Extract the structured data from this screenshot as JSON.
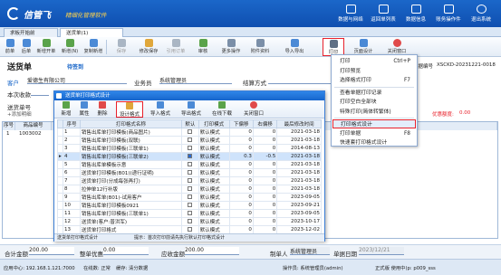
{
  "app": {
    "logo": "信管飞",
    "subtitle": "精细化管理软件"
  },
  "topbar": {
    "buttons": [
      "数据与网络",
      "返回单列表",
      "数据信息",
      "账务操作件",
      "退出系统"
    ]
  },
  "tabs": [
    "求板开始前",
    "送货单(1)"
  ],
  "toolbar": {
    "buttons": [
      "前单",
      "后单",
      "新增开单",
      "新增(N)",
      "复制新增",
      "保存",
      "修改保存",
      "引用订单",
      "审核",
      "附件资料",
      "导入导出",
      "打印",
      "页面设计",
      "关闭窗口"
    ]
  },
  "form": {
    "title": "送货单",
    "status": "待签到",
    "doc_no_label": "单据编号",
    "doc_no": "XSCKD-20231221-0018",
    "customer_label": "客户",
    "customer": "爱德生有限公司",
    "salesman_label": "业务员",
    "salesman": "系统管理员",
    "settle_label": "结算方式",
    "deposit_label": "本次收款",
    "address_label": "送货单号",
    "grid_headers": [
      "序号",
      "商品编号"
    ],
    "grid_row": [
      "1",
      "1003002"
    ],
    "discount_label": "优惠额度:",
    "discount_value": "0.00"
  },
  "dialog": {
    "title": "送货单打印格式设计",
    "toolbar": [
      "新增",
      "属性",
      "删除",
      "设计格式",
      "导入格式",
      "导出格式",
      "在线下载",
      "关闭窗口"
    ],
    "columns": [
      "序号",
      "打印格式名称",
      "默认",
      "打印模式",
      "下偏移",
      "右偏移",
      "最后修改时间"
    ],
    "rows": [
      [
        "1",
        "销售出库单打印模板(商品图片)",
        "",
        "默认模式",
        "0",
        "0",
        "2021-03-18"
      ],
      [
        "2",
        "销售出库单打印模板(双联)",
        "",
        "默认模式",
        "0",
        "0",
        "2021-03-18"
      ],
      [
        "3",
        "销售出库单打印模板(三联单1)",
        "",
        "默认模式",
        "0",
        "0",
        "2014-08-13"
      ],
      [
        "4",
        "销售出库单打印模板(三联单2)",
        "✓",
        "默认模式",
        "0.3",
        "-0.5",
        "2021-03-18"
      ],
      [
        "5",
        "销售出库单模板示意",
        "",
        "默认模式",
        "0",
        "0",
        "2021-03-18"
      ],
      [
        "6",
        "送货单打印模板(B01)(递行证明)",
        "",
        "默认模式",
        "0",
        "0",
        "2021-03-18"
      ],
      [
        "7",
        "送货单打印(分成每张再打)",
        "",
        "默认模式",
        "0",
        "0",
        "2021-03-18"
      ],
      [
        "8",
        "拉伸单12行补版",
        "",
        "默认模式",
        "0",
        "0",
        "2021-03-18"
      ],
      [
        "9",
        "销售出库单(B01)-试用客户",
        "",
        "默认模式",
        "0",
        "0",
        "2023-09-05"
      ],
      [
        "10",
        "销售出库单打印模板0921",
        "",
        "默认模式",
        "0",
        "0",
        "2023-09-21"
      ],
      [
        "11",
        "销售出库单打印模板(三联单1)",
        "",
        "默认模式",
        "0",
        "0",
        "2023-09-05"
      ],
      [
        "12",
        "送货单(客户:普洪军)",
        "",
        "默认模式",
        "0",
        "0",
        "2023-10-17"
      ],
      [
        "13",
        "送货单打印格式",
        "",
        "默认模式",
        "0",
        "0",
        "2023-12-02"
      ]
    ],
    "status": "送货单打印格式设计",
    "hint": "提示：首次打印前请先执行默认打印格式设计"
  },
  "menu": {
    "items": [
      {
        "label": "打印",
        "shortcut": "Ctrl+P"
      },
      {
        "label": "打印预览",
        "shortcut": ""
      },
      {
        "label": "选择格式打印",
        "shortcut": "F7"
      },
      {
        "label": "查看单据打印记录",
        "shortcut": ""
      },
      {
        "label": "打印空白全部块",
        "shortcut": ""
      },
      {
        "label": "特殊打印(简体转繁体)",
        "shortcut": ""
      },
      {
        "label": "打印格式设计",
        "shortcut": ""
      },
      {
        "label": "打印单据",
        "shortcut": "F8"
      },
      {
        "label": "快速套打印格式设计",
        "shortcut": ""
      }
    ]
  },
  "footer": {
    "total_label": "合计金额",
    "total": "200.00",
    "adjust_label": "整单优惠",
    "adjust": "0.00",
    "receivable_label": "应收金额",
    "receivable": "200.00",
    "maker_label": "制单人",
    "maker": "系统管理员",
    "date_label": "单据日期",
    "date": "2023/12/21"
  },
  "statusbar": {
    "server": "应用中心: 192.168.1.121:7000",
    "state": "在线数: 正常",
    "cache": "缓存: 清分数据",
    "operator": "操作员: 系统管理员(admin)",
    "version": "正式版 使用中(p: p009_sss"
  },
  "colors": {
    "brand": "#1b67c9",
    "accent": "#e8212b",
    "selection": "#cfe3fb"
  }
}
